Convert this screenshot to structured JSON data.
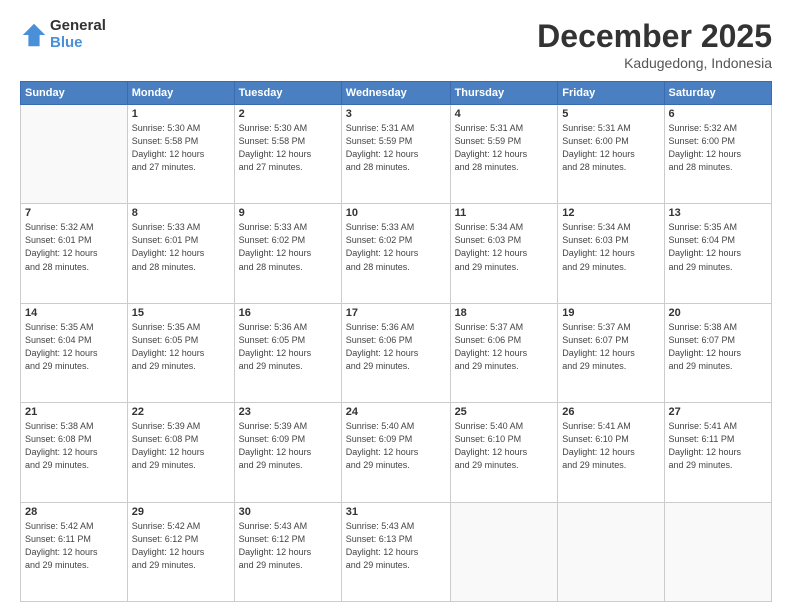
{
  "logo": {
    "general": "General",
    "blue": "Blue"
  },
  "header": {
    "month": "December 2025",
    "location": "Kadugedong, Indonesia"
  },
  "days_of_week": [
    "Sunday",
    "Monday",
    "Tuesday",
    "Wednesday",
    "Thursday",
    "Friday",
    "Saturday"
  ],
  "weeks": [
    [
      {
        "day": "",
        "info": ""
      },
      {
        "day": "1",
        "info": "Sunrise: 5:30 AM\nSunset: 5:58 PM\nDaylight: 12 hours\nand 27 minutes."
      },
      {
        "day": "2",
        "info": "Sunrise: 5:30 AM\nSunset: 5:58 PM\nDaylight: 12 hours\nand 27 minutes."
      },
      {
        "day": "3",
        "info": "Sunrise: 5:31 AM\nSunset: 5:59 PM\nDaylight: 12 hours\nand 28 minutes."
      },
      {
        "day": "4",
        "info": "Sunrise: 5:31 AM\nSunset: 5:59 PM\nDaylight: 12 hours\nand 28 minutes."
      },
      {
        "day": "5",
        "info": "Sunrise: 5:31 AM\nSunset: 6:00 PM\nDaylight: 12 hours\nand 28 minutes."
      },
      {
        "day": "6",
        "info": "Sunrise: 5:32 AM\nSunset: 6:00 PM\nDaylight: 12 hours\nand 28 minutes."
      }
    ],
    [
      {
        "day": "7",
        "info": "Sunrise: 5:32 AM\nSunset: 6:01 PM\nDaylight: 12 hours\nand 28 minutes."
      },
      {
        "day": "8",
        "info": "Sunrise: 5:33 AM\nSunset: 6:01 PM\nDaylight: 12 hours\nand 28 minutes."
      },
      {
        "day": "9",
        "info": "Sunrise: 5:33 AM\nSunset: 6:02 PM\nDaylight: 12 hours\nand 28 minutes."
      },
      {
        "day": "10",
        "info": "Sunrise: 5:33 AM\nSunset: 6:02 PM\nDaylight: 12 hours\nand 28 minutes."
      },
      {
        "day": "11",
        "info": "Sunrise: 5:34 AM\nSunset: 6:03 PM\nDaylight: 12 hours\nand 29 minutes."
      },
      {
        "day": "12",
        "info": "Sunrise: 5:34 AM\nSunset: 6:03 PM\nDaylight: 12 hours\nand 29 minutes."
      },
      {
        "day": "13",
        "info": "Sunrise: 5:35 AM\nSunset: 6:04 PM\nDaylight: 12 hours\nand 29 minutes."
      }
    ],
    [
      {
        "day": "14",
        "info": "Sunrise: 5:35 AM\nSunset: 6:04 PM\nDaylight: 12 hours\nand 29 minutes."
      },
      {
        "day": "15",
        "info": "Sunrise: 5:35 AM\nSunset: 6:05 PM\nDaylight: 12 hours\nand 29 minutes."
      },
      {
        "day": "16",
        "info": "Sunrise: 5:36 AM\nSunset: 6:05 PM\nDaylight: 12 hours\nand 29 minutes."
      },
      {
        "day": "17",
        "info": "Sunrise: 5:36 AM\nSunset: 6:06 PM\nDaylight: 12 hours\nand 29 minutes."
      },
      {
        "day": "18",
        "info": "Sunrise: 5:37 AM\nSunset: 6:06 PM\nDaylight: 12 hours\nand 29 minutes."
      },
      {
        "day": "19",
        "info": "Sunrise: 5:37 AM\nSunset: 6:07 PM\nDaylight: 12 hours\nand 29 minutes."
      },
      {
        "day": "20",
        "info": "Sunrise: 5:38 AM\nSunset: 6:07 PM\nDaylight: 12 hours\nand 29 minutes."
      }
    ],
    [
      {
        "day": "21",
        "info": "Sunrise: 5:38 AM\nSunset: 6:08 PM\nDaylight: 12 hours\nand 29 minutes."
      },
      {
        "day": "22",
        "info": "Sunrise: 5:39 AM\nSunset: 6:08 PM\nDaylight: 12 hours\nand 29 minutes."
      },
      {
        "day": "23",
        "info": "Sunrise: 5:39 AM\nSunset: 6:09 PM\nDaylight: 12 hours\nand 29 minutes."
      },
      {
        "day": "24",
        "info": "Sunrise: 5:40 AM\nSunset: 6:09 PM\nDaylight: 12 hours\nand 29 minutes."
      },
      {
        "day": "25",
        "info": "Sunrise: 5:40 AM\nSunset: 6:10 PM\nDaylight: 12 hours\nand 29 minutes."
      },
      {
        "day": "26",
        "info": "Sunrise: 5:41 AM\nSunset: 6:10 PM\nDaylight: 12 hours\nand 29 minutes."
      },
      {
        "day": "27",
        "info": "Sunrise: 5:41 AM\nSunset: 6:11 PM\nDaylight: 12 hours\nand 29 minutes."
      }
    ],
    [
      {
        "day": "28",
        "info": "Sunrise: 5:42 AM\nSunset: 6:11 PM\nDaylight: 12 hours\nand 29 minutes."
      },
      {
        "day": "29",
        "info": "Sunrise: 5:42 AM\nSunset: 6:12 PM\nDaylight: 12 hours\nand 29 minutes."
      },
      {
        "day": "30",
        "info": "Sunrise: 5:43 AM\nSunset: 6:12 PM\nDaylight: 12 hours\nand 29 minutes."
      },
      {
        "day": "31",
        "info": "Sunrise: 5:43 AM\nSunset: 6:13 PM\nDaylight: 12 hours\nand 29 minutes."
      },
      {
        "day": "",
        "info": ""
      },
      {
        "day": "",
        "info": ""
      },
      {
        "day": "",
        "info": ""
      }
    ]
  ]
}
